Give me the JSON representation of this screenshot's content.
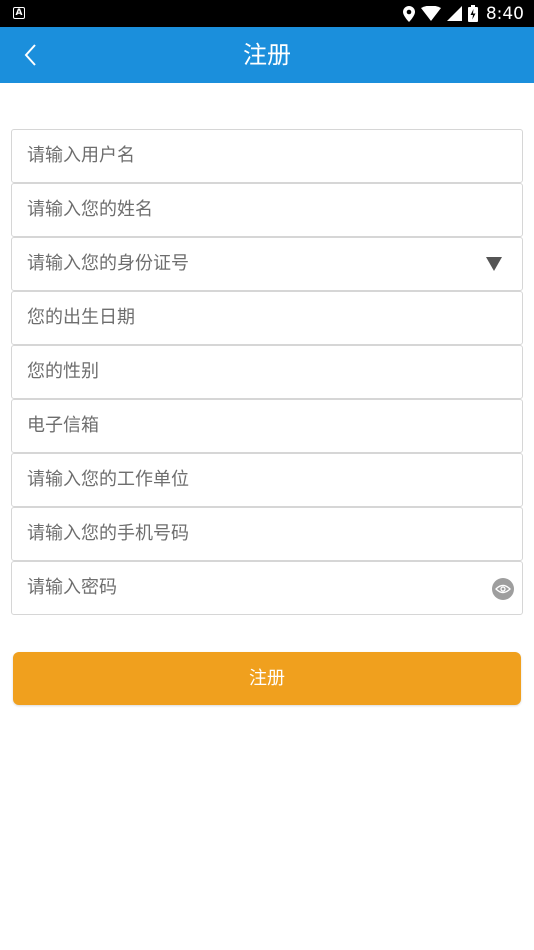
{
  "status_bar": {
    "time": "8:40",
    "left_icon": "A",
    "icons": [
      "location-icon",
      "wifi-icon",
      "signal-icon",
      "battery-icon"
    ]
  },
  "app_bar": {
    "title": "注册",
    "back_icon": "chevron-left-icon",
    "color": "#1b8fdc"
  },
  "form": {
    "username": {
      "placeholder": "请输入用户名"
    },
    "name": {
      "placeholder": "请输入您的姓名"
    },
    "id_type": {
      "placeholder": "请输入您的身份证号",
      "icon": "dropdown-arrow-icon"
    },
    "birth_date": {
      "placeholder": "您的出生日期"
    },
    "gender": {
      "placeholder": "您的性别"
    },
    "email": {
      "placeholder": "电子信箱"
    },
    "work_unit": {
      "placeholder": "请输入您的工作单位"
    },
    "phone": {
      "placeholder": "请输入您的手机号码"
    },
    "password": {
      "placeholder": "请输入密码",
      "icon": "eye-icon"
    }
  },
  "register_button": {
    "label": "注册",
    "color": "#f0a01e"
  }
}
